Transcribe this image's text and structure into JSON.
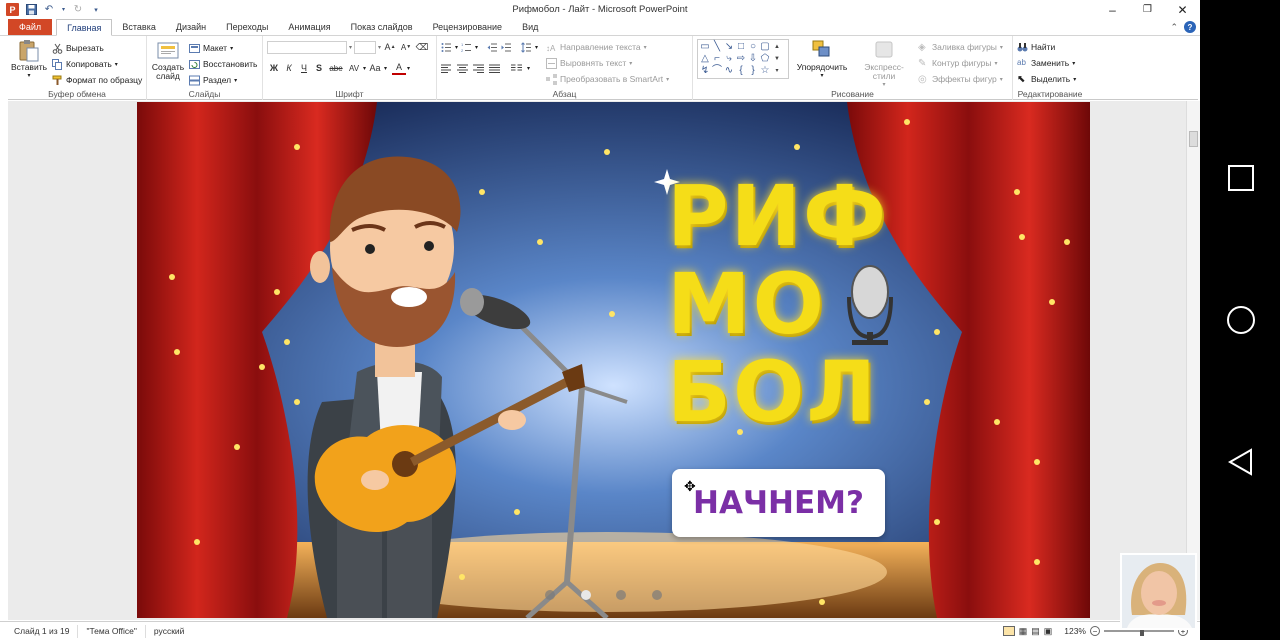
{
  "window": {
    "title": "Рифмобол - Лайт - Microsoft PowerPoint",
    "logo_letter": "P"
  },
  "tabs": [
    {
      "label": "Файл"
    },
    {
      "label": "Главная"
    },
    {
      "label": "Вставка"
    },
    {
      "label": "Дизайн"
    },
    {
      "label": "Переходы"
    },
    {
      "label": "Анимация"
    },
    {
      "label": "Показ слайдов"
    },
    {
      "label": "Рецензирование"
    },
    {
      "label": "Вид"
    }
  ],
  "ribbon": {
    "clipboard": {
      "label": "Буфер обмена",
      "paste": "Вставить",
      "cut": "Вырезать",
      "copy": "Копировать",
      "format_painter": "Формат по образцу"
    },
    "slides": {
      "label": "Слайды",
      "new_slide_line1": "Создать",
      "new_slide_line2": "слайд",
      "layout": "Макет",
      "reset": "Восстановить",
      "section": "Раздел"
    },
    "font": {
      "label": "Шрифт",
      "bold": "Ж",
      "italic": "К",
      "underline": "Ч",
      "strike": "S",
      "shadow": "abe",
      "spacing": "AV",
      "case": "Aa",
      "color": "A"
    },
    "paragraph": {
      "label": "Абзац",
      "text_direction": "Направление текста",
      "align_text": "Выровнять текст",
      "smartart": "Преобразовать в SmartArt"
    },
    "drawing": {
      "label": "Рисование",
      "arrange": "Упорядочить",
      "quick_styles": "Экспресс-стили",
      "shape_fill": "Заливка фигуры",
      "shape_outline": "Контур фигуры",
      "shape_effects": "Эффекты фигур"
    },
    "editing": {
      "label": "Редактирование",
      "find": "Найти",
      "replace": "Заменить",
      "select": "Выделить"
    }
  },
  "slide": {
    "title_line1": "РИФ",
    "title_line2": "МО",
    "title_line3": "БОЛ",
    "button_label": "НАЧНЕМ?"
  },
  "status": {
    "slide_info": "Слайд 1 из 19",
    "theme": "\"Тема Office\"",
    "language": "русский",
    "zoom": "123%"
  }
}
